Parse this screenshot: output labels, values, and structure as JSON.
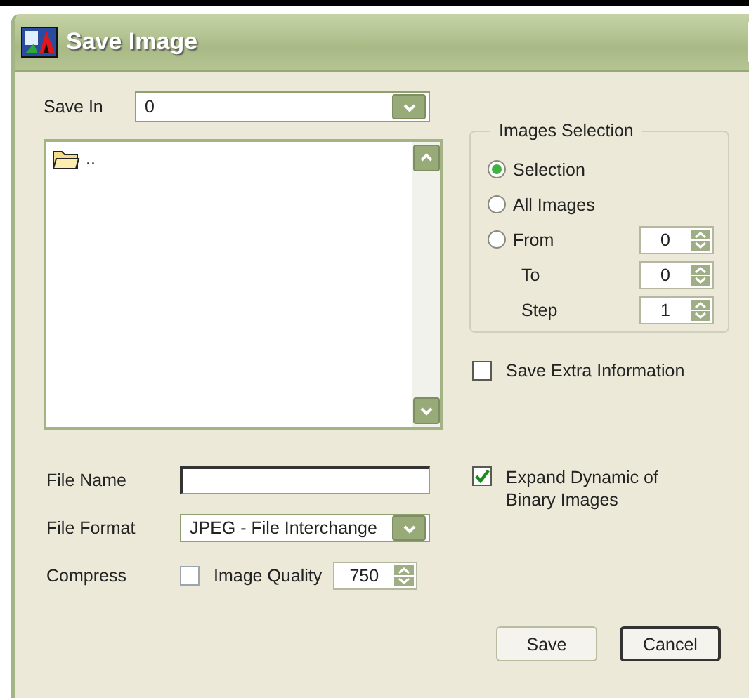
{
  "window": {
    "title": "Save Image"
  },
  "save_in": {
    "label": "Save In",
    "value": "0"
  },
  "file_list": {
    "items": [
      {
        "name": "..",
        "kind": "folder"
      }
    ]
  },
  "images_selection": {
    "title": "Images Selection",
    "rows": [
      {
        "kind": "radio",
        "label": "Selection",
        "selected": true
      },
      {
        "kind": "radio",
        "label": "All Images",
        "selected": false
      },
      {
        "kind": "radio",
        "label": "From",
        "selected": false,
        "value": "0"
      },
      {
        "kind": "spinner",
        "label": "To",
        "value": "0"
      },
      {
        "kind": "spinner",
        "label": "Step",
        "value": "1"
      }
    ]
  },
  "save_extra": {
    "label": "Save Extra Information",
    "checked": false
  },
  "file_name": {
    "label": "File Name"
  },
  "expand_dynamic": {
    "label": "Expand Dynamic of Binary Images",
    "checked": true
  },
  "file_format": {
    "label": "File Format",
    "value": "JPEG - File Interchange"
  },
  "compress": {
    "label": "Compress",
    "checked": false
  },
  "image_quality": {
    "label": "Image Quality",
    "value": "750"
  },
  "buttons": [
    {
      "label": "Save",
      "focused": false
    },
    {
      "label": "Cancel",
      "focused": true
    }
  ]
}
